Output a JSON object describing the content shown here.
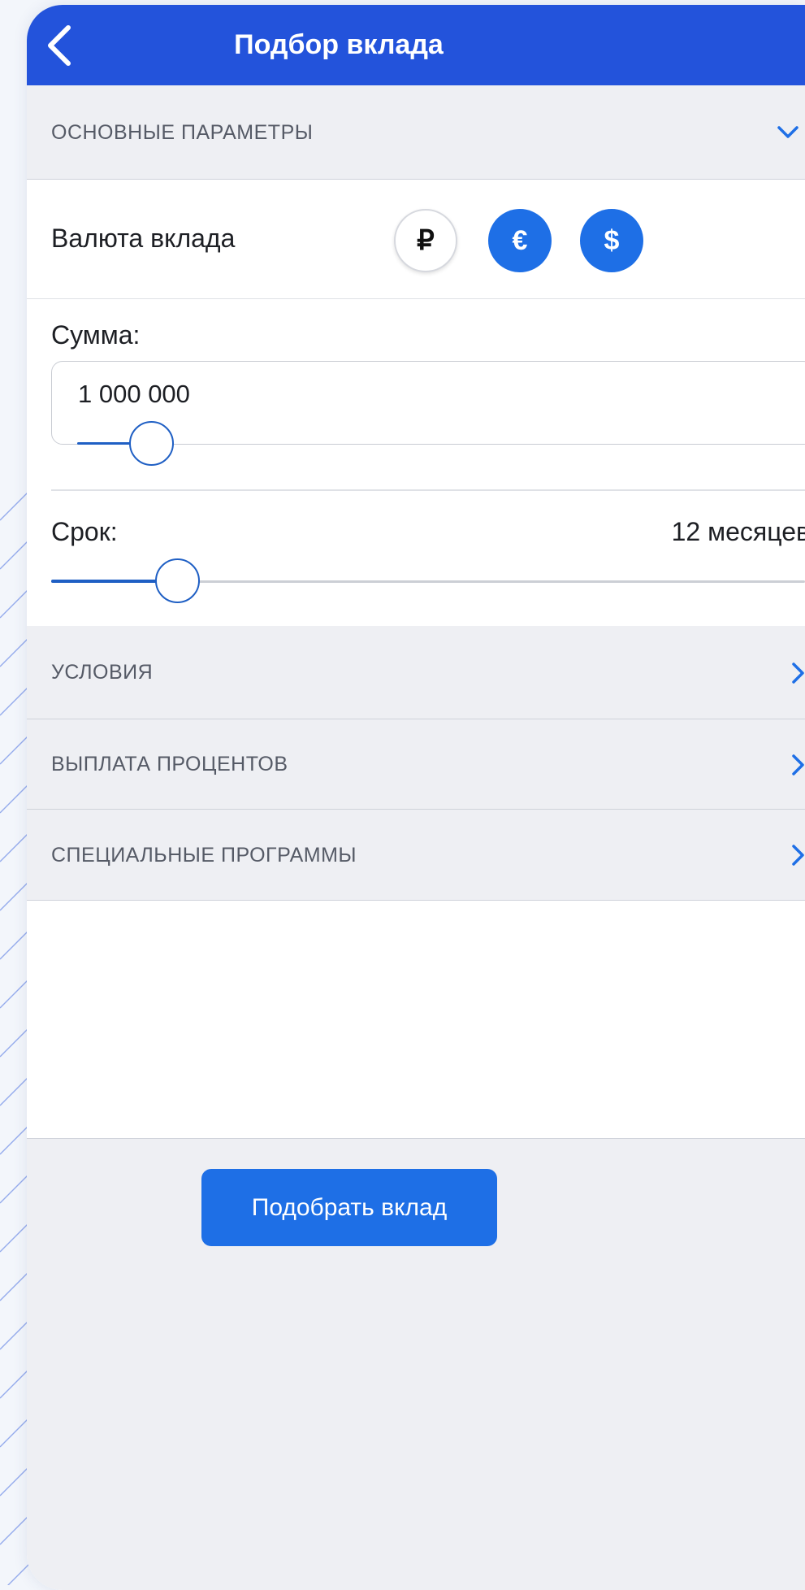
{
  "header": {
    "title": "Подбор вклада",
    "back_icon": "chevron-left-icon"
  },
  "sections": {
    "main_params": {
      "label": "ОСНОВНЫЕ ПАРАМЕТРЫ",
      "icon": "chevron-down-icon",
      "expanded": true
    },
    "conditions": {
      "label": "УСЛОВИЯ",
      "icon": "chevron-right-icon"
    },
    "interest_payment": {
      "label": "ВЫПЛАТА ПРОЦЕНТОВ",
      "icon": "chevron-right-icon"
    },
    "special_programs": {
      "label": "СПЕЦИАЛЬНЫЕ ПРОГРАММЫ",
      "icon": "chevron-right-icon"
    }
  },
  "currency": {
    "label": "Валюта вклада",
    "options": [
      {
        "symbol": "₽",
        "name": "rub",
        "selected": true
      },
      {
        "symbol": "€",
        "name": "eur",
        "selected": false
      },
      {
        "symbol": "$",
        "name": "usd",
        "selected": false
      }
    ]
  },
  "amount": {
    "label": "Сумма:",
    "value": "1 000 000"
  },
  "term": {
    "label": "Срок:",
    "value_text": "12 месяцев",
    "slider_fraction": 0.17
  },
  "actions": {
    "submit_label": "Подобрать вклад"
  },
  "colors": {
    "header": "#2353db",
    "accent": "#1e6fe6",
    "section_bg": "#eeeff3"
  }
}
